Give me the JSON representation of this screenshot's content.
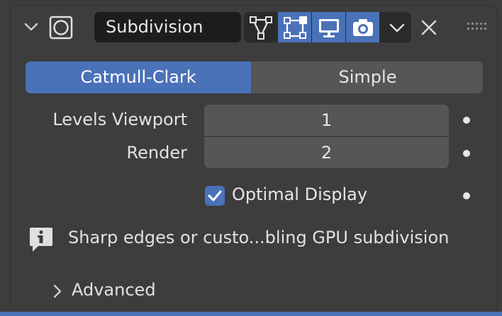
{
  "modifier": {
    "name": "Subdivision",
    "toggles": [
      {
        "name": "edit-mode",
        "active": false
      },
      {
        "name": "cage",
        "active": true
      },
      {
        "name": "viewport",
        "active": true
      },
      {
        "name": "render",
        "active": true
      }
    ]
  },
  "algorithm": {
    "options": [
      "Catmull-Clark",
      "Simple"
    ],
    "selected": "Catmull-Clark"
  },
  "levels": {
    "viewport_label": "Levels Viewport",
    "viewport_value": "1",
    "render_label": "Render",
    "render_value": "2"
  },
  "optimal_display": {
    "label": "Optimal Display",
    "checked": true
  },
  "info": {
    "text": "Sharp edges or custo...bling GPU subdivision"
  },
  "advanced": {
    "label": "Advanced"
  },
  "colors": {
    "panel": "#3d3d3d",
    "accent": "#4a72b8",
    "field_dark": "#1d1d1d",
    "button": "#565656",
    "text": "#e6e6e6"
  }
}
